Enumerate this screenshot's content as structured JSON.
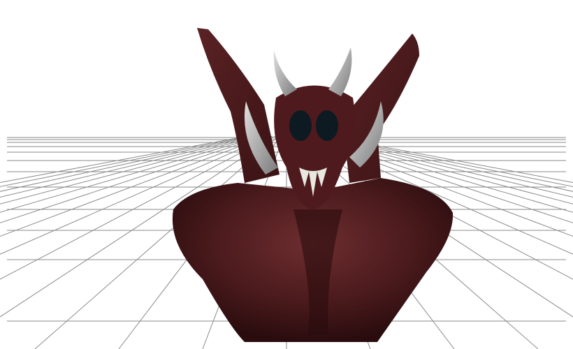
{
  "scene": {
    "background_color": "#ffffff",
    "grid_color": "#8a8a8a",
    "model": {
      "subject": "demon-bust",
      "skin_color": "#4a1a1c",
      "skin_highlight": "#7a3a3c",
      "horn_color": "#bdbdbd",
      "eye_color": "#0d1a22",
      "teeth_color": "#e8e8e0"
    }
  }
}
